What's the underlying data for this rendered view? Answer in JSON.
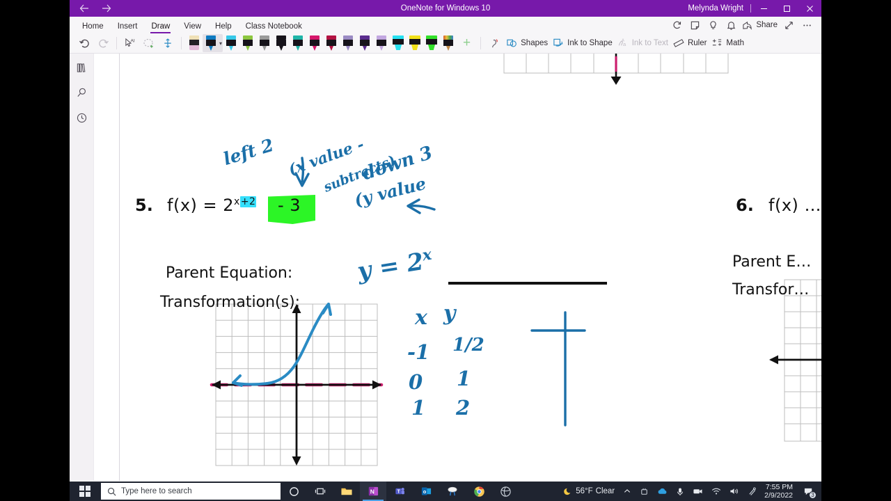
{
  "titlebar": {
    "app_title": "OneNote for Windows 10",
    "user_name": "Melynda Wright",
    "back_icon": "back-arrow-icon",
    "forward_icon": "forward-arrow-icon",
    "minimize_label": "–",
    "maximize_label": "❐",
    "close_label": "✕",
    "accent_color": "#7719aa"
  },
  "ribbon": {
    "tabs": [
      {
        "label": "Home",
        "active": false
      },
      {
        "label": "Insert",
        "active": false
      },
      {
        "label": "Draw",
        "active": true
      },
      {
        "label": "View",
        "active": false
      },
      {
        "label": "Help",
        "active": false
      },
      {
        "label": "Class Notebook",
        "active": false
      }
    ],
    "right_commands": [
      {
        "label": "",
        "icon": "sync-icon"
      },
      {
        "label": "",
        "icon": "sticky-note-icon"
      },
      {
        "label": "",
        "icon": "lightbulb-icon"
      },
      {
        "label": "",
        "icon": "bell-icon"
      },
      {
        "label": "Share",
        "icon": "share-icon"
      },
      {
        "label": "",
        "icon": "expand-icon"
      },
      {
        "label": "",
        "icon": "more-options-icon"
      }
    ],
    "undo_label": "↶",
    "redo_label": "↷",
    "lasso_label": "Lasso Select",
    "pens": [
      {
        "name": "eraser",
        "cap": "#efe0b6",
        "body": "#231f26",
        "nib": "#e2b9d8",
        "kind": "eraser",
        "selected": false
      },
      {
        "name": "pen-blue",
        "cap": "#0f7ac0",
        "body": "#16131a",
        "nib": "#0f7ac0",
        "kind": "pen",
        "selected": true
      },
      {
        "name": "pen-cyan",
        "cap": "#37c8e8",
        "body": "#16131a",
        "nib": "#37c8e8",
        "kind": "pen",
        "selected": false
      },
      {
        "name": "pen-green",
        "cap": "#8cc63f",
        "body": "#16131a",
        "nib": "#8cc63f",
        "kind": "pen",
        "selected": false
      },
      {
        "name": "pen-silver",
        "cap": "#9a9a9a",
        "body": "#16131a",
        "nib": "#9a9a9a",
        "kind": "pen",
        "selected": false
      },
      {
        "name": "pen-black",
        "cap": "#16131a",
        "body": "#16131a",
        "nib": "#16131a",
        "kind": "pen",
        "selected": false
      },
      {
        "name": "pen-teal",
        "cap": "#1fb5a8",
        "body": "#16131a",
        "nib": "#1fb5a8",
        "kind": "pen",
        "selected": false
      },
      {
        "name": "pen-magenta",
        "cap": "#d6176b",
        "body": "#16131a",
        "nib": "#d6176b",
        "kind": "pen",
        "selected": false
      },
      {
        "name": "pen-crimson",
        "cap": "#b31242",
        "body": "#16131a",
        "nib": "#b31242",
        "kind": "pen",
        "selected": false
      },
      {
        "name": "pen-lightpurple",
        "cap": "#9b8bc4",
        "body": "#16131a",
        "nib": "#9b8bc4",
        "kind": "pen",
        "selected": false
      },
      {
        "name": "pen-darkpurple",
        "cap": "#5b2d8e",
        "body": "#16131a",
        "nib": "#5b2d8e",
        "kind": "pen",
        "selected": false
      },
      {
        "name": "pen-lavender",
        "cap": "#c2a7e0",
        "body": "#16131a",
        "nib": "#c2a7e0",
        "kind": "pen",
        "selected": false
      },
      {
        "name": "highlighter-cyan",
        "cap": "#27e0f0",
        "body": "#16131a",
        "nib": "#27e0f0",
        "kind": "highlighter",
        "selected": false
      },
      {
        "name": "highlighter-yellow",
        "cap": "#f2e11a",
        "body": "#16131a",
        "nib": "#f2e11a",
        "kind": "highlighter",
        "selected": false
      },
      {
        "name": "highlighter-green",
        "cap": "#33e02a",
        "body": "#16131a",
        "nib": "#33e02a",
        "kind": "highlighter",
        "selected": false
      },
      {
        "name": "pencil-rainbow",
        "cap": "rainbow",
        "body": "#16131a",
        "nib": "#c08a4a",
        "kind": "pencil",
        "selected": false
      }
    ],
    "add_pen_label": "+",
    "tools": [
      {
        "label": "Shapes",
        "icon": "shapes-icon",
        "disabled": false
      },
      {
        "label": "Ink to Shape",
        "icon": "ink-to-shape-icon",
        "disabled": false
      },
      {
        "label": "Ink to Text",
        "icon": "ink-to-text-icon",
        "disabled": true
      },
      {
        "label": "Ruler",
        "icon": "ruler-icon",
        "disabled": false
      },
      {
        "label": "Math",
        "icon": "math-icon",
        "disabled": false
      }
    ]
  },
  "navrail": {
    "items": [
      {
        "name": "notebooks",
        "icon": "notebooks-icon"
      },
      {
        "name": "search",
        "icon": "search-icon"
      },
      {
        "name": "recent",
        "icon": "clock-icon"
      }
    ]
  },
  "worksheet": {
    "problem5": {
      "number": "5.",
      "equation_prefix": "f(x) = 2",
      "exponent_base": "x",
      "exponent_highlighted": "+2",
      "constant_term": "- 3",
      "parent_equation_label": "Parent Equation:",
      "transformations_label": "Transformation(s):",
      "highlight_cyan": "#35dffb",
      "highlight_green": "#2cf526"
    },
    "problem6": {
      "number": "6.",
      "equation_prefix": "f(x) …",
      "parent_equation_label": "Parent E…",
      "transformations_label": "Transfor…"
    },
    "ink_annotations": [
      {
        "text": "left 2",
        "name": "ink-left-2"
      },
      {
        "text": "(x value -",
        "name": "ink-x-value"
      },
      {
        "text": "subtracts)",
        "name": "ink-subtracts"
      },
      {
        "text": "down 3",
        "name": "ink-down-3"
      },
      {
        "text": "(y value",
        "name": "ink-y-value"
      },
      {
        "text": "y = 2",
        "name": "ink-parent-equation"
      },
      {
        "text": "x",
        "name": "ink-parent-exponent"
      }
    ],
    "ink_table": {
      "header_x": "x",
      "header_y": "y",
      "rows": [
        {
          "x": "-1",
          "y": "1/2"
        },
        {
          "x": "0",
          "y": "1"
        },
        {
          "x": "1",
          "y": "2"
        }
      ]
    },
    "ink_colors": {
      "ink_blue": "#1b6fa8",
      "curve_blue": "#2a8bc4",
      "asymptote_magenta": "#cc1f6e"
    },
    "graph": {
      "grid_color": "#bdbdbd",
      "axis_color": "#111111",
      "cols": 10,
      "rows": 10
    }
  },
  "taskbar": {
    "start_label": "Start",
    "search_placeholder": "Type here to search",
    "search_icon": "search-icon",
    "cortana_icon": "cortana-icon",
    "taskview_icon": "task-view-icon",
    "apps": [
      {
        "name": "file-explorer",
        "label": "File Explorer",
        "active": false
      },
      {
        "name": "onenote",
        "label": "OneNote",
        "active": true
      },
      {
        "name": "teams",
        "label": "Microsoft Teams",
        "active": false
      },
      {
        "name": "outlook",
        "label": "Outlook",
        "active": false
      },
      {
        "name": "snipping-tool",
        "label": "Snip & Sketch",
        "active": false
      },
      {
        "name": "chrome",
        "label": "Google Chrome",
        "active": false
      },
      {
        "name": "browser",
        "label": "Browser",
        "active": false
      }
    ],
    "weather": {
      "icon": "moon-icon",
      "temperature": "56°F",
      "condition": "Clear"
    },
    "tray": [
      {
        "name": "show-hidden-icons",
        "icon": "chevron-up-icon"
      },
      {
        "name": "snip-tool-tray",
        "icon": "snip-icon"
      },
      {
        "name": "onedrive",
        "icon": "cloud-icon"
      },
      {
        "name": "microphone",
        "icon": "microphone-icon"
      },
      {
        "name": "webcam",
        "icon": "webcam-icon"
      },
      {
        "name": "network",
        "icon": "wifi-icon"
      },
      {
        "name": "volume",
        "icon": "speaker-icon"
      },
      {
        "name": "bluetooth",
        "icon": "pen-tray-icon"
      }
    ],
    "clock": {
      "time": "7:55 PM",
      "date": "2/9/2022"
    },
    "notifications": {
      "icon": "notification-icon",
      "count": "3"
    }
  }
}
